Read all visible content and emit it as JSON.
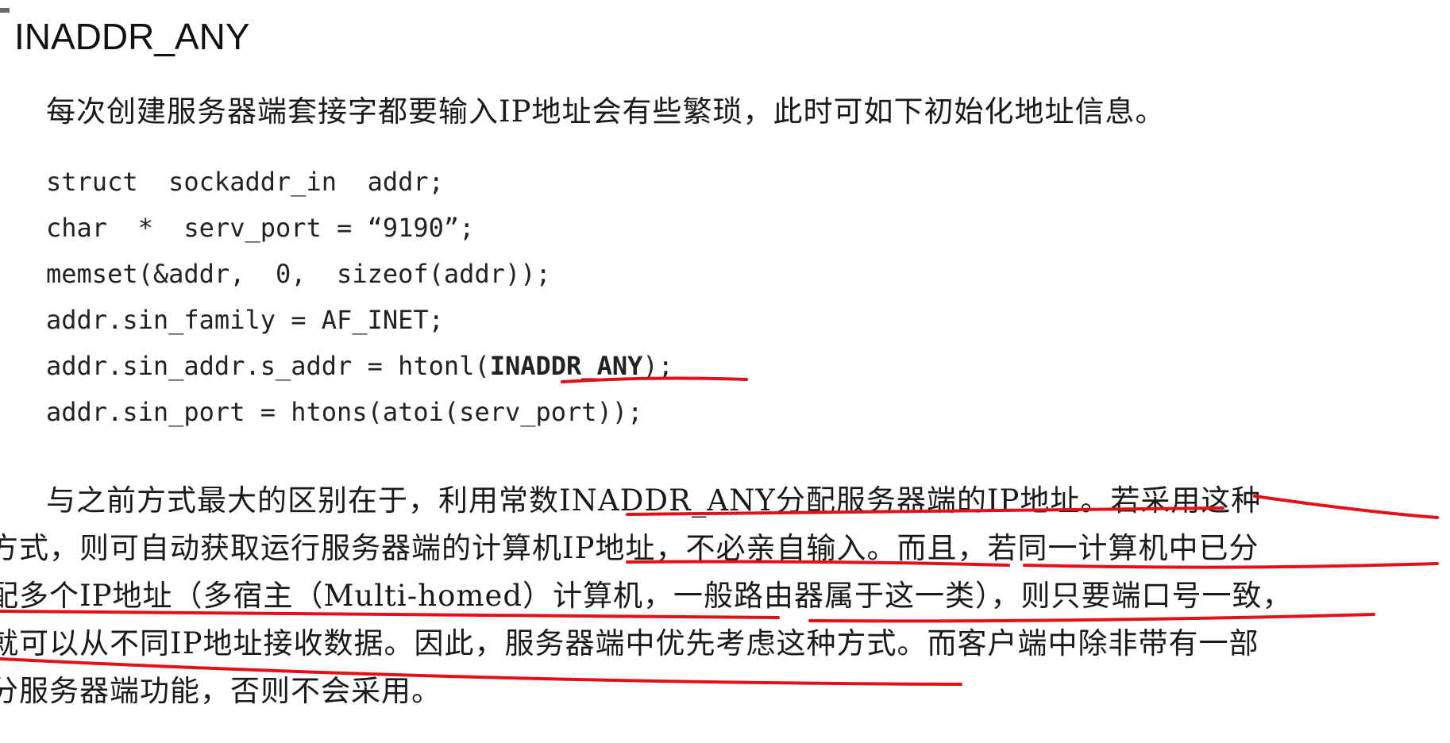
{
  "heading": "INADDR_ANY",
  "intro": "每次创建服务器端套接字都要输入IP地址会有些繁琐，此时可如下初始化地址信息。",
  "code": {
    "line1": "struct  sockaddr_in  addr;",
    "line2": "char  *  serv_port = “9190”;",
    "line3": "memset(&addr,  0,  sizeof(addr));",
    "line4": "addr.sin_family = AF_INET;",
    "line5_pre": "addr.sin_addr.s_addr = htonl(",
    "line5_kw": "INADDR_ANY",
    "line5_post": ");",
    "line6": "addr.sin_port = htons(atoi(serv_port));"
  },
  "paragraph": {
    "line1": "与之前方式最大的区别在于，利用常数INADDR_ANY分配服务器端的IP地址。若采用这种",
    "line2": "方式，则可自动获取运行服务器端的计算机IP地址，不必亲自输入。而且，若同一计算机中已分",
    "line3": "配多个IP地址（多宿主（Multi-homed）计算机，一般路由器属于这一类），则只要端口号一致，",
    "line4": "就可以从不同IP地址接收数据。因此，服务器端中优先考虑这种方式。而客户端中除非带有一部",
    "line5": "分服务器端功能，否则不会采用。"
  },
  "colors": {
    "text": "#1a1a1a",
    "annotation": "#e3101a"
  }
}
